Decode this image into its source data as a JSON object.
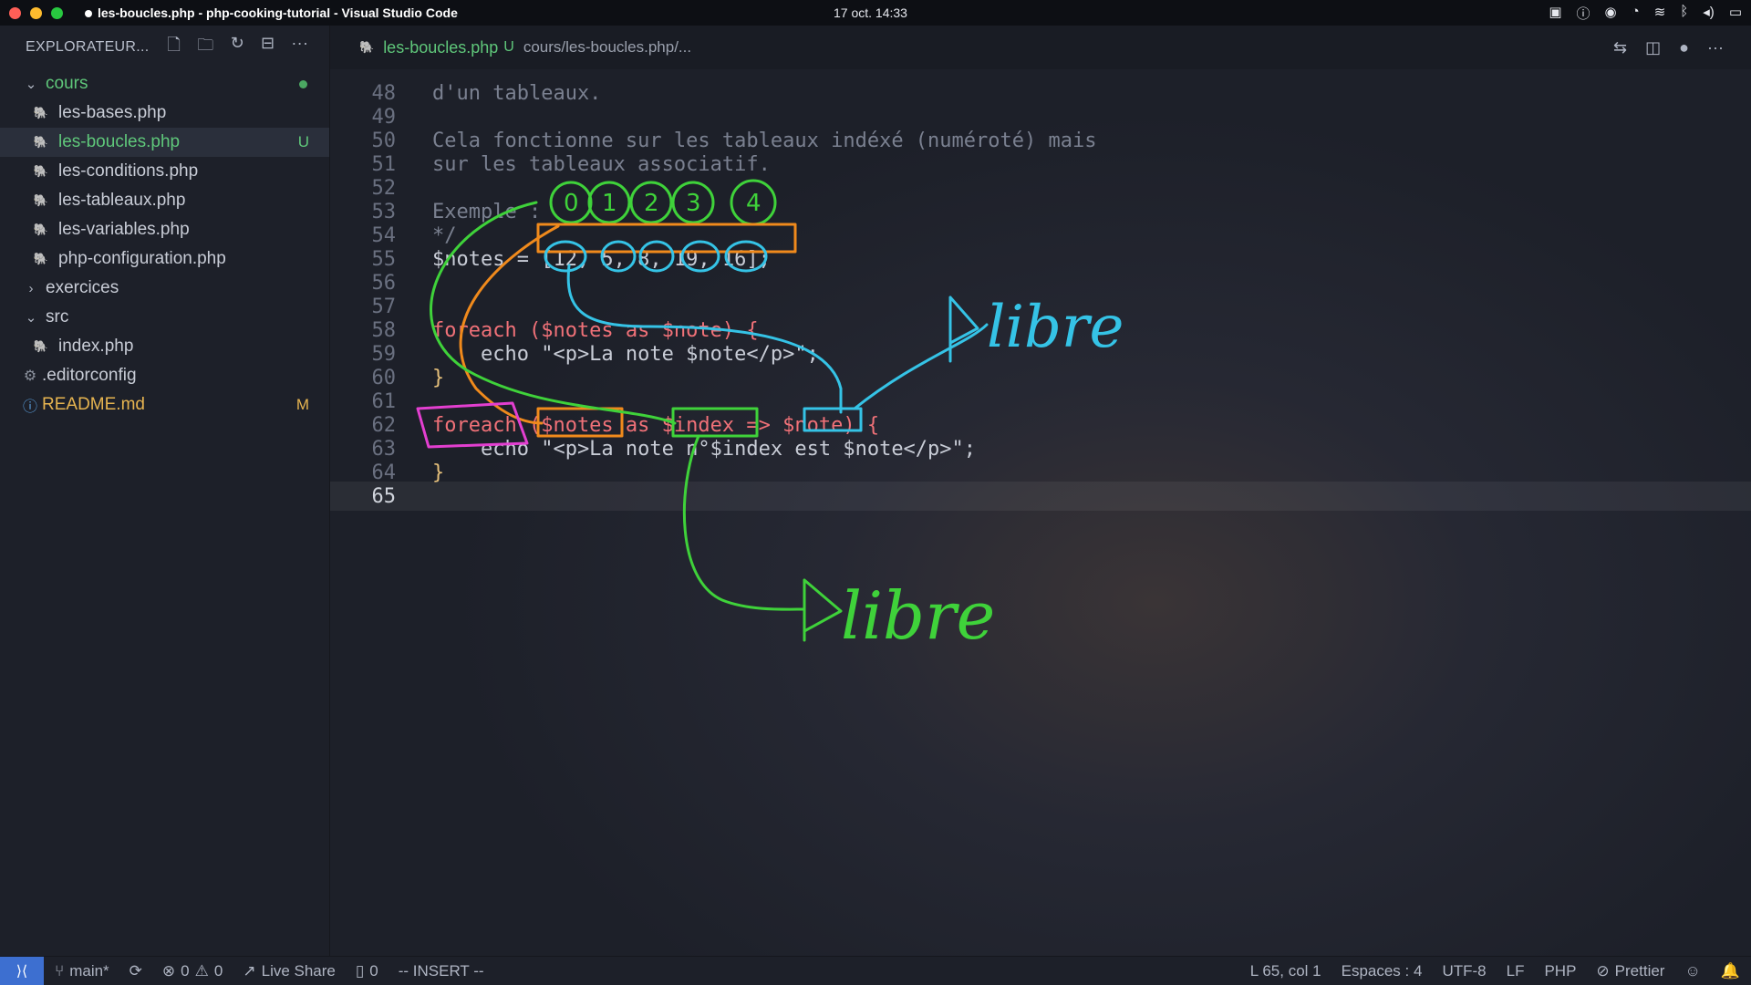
{
  "window": {
    "title": "les-boucles.php - php-cooking-tutorial - Visual Studio Code",
    "clock": "17 oct.  14:33"
  },
  "sidebar": {
    "title": "EXPLORATEUR...",
    "items": [
      {
        "label": "cours",
        "kind": "folder",
        "expanded": true,
        "status": ""
      },
      {
        "label": "les-bases.php",
        "kind": "php",
        "status": ""
      },
      {
        "label": "les-boucles.php",
        "kind": "php",
        "status": "U"
      },
      {
        "label": "les-conditions.php",
        "kind": "php",
        "status": ""
      },
      {
        "label": "les-tableaux.php",
        "kind": "php",
        "status": ""
      },
      {
        "label": "les-variables.php",
        "kind": "php",
        "status": ""
      },
      {
        "label": "php-configuration.php",
        "kind": "php",
        "status": ""
      },
      {
        "label": "exercices",
        "kind": "folder",
        "expanded": false,
        "status": ""
      },
      {
        "label": "src",
        "kind": "folder",
        "expanded": true,
        "status": ""
      },
      {
        "label": "index.php",
        "kind": "php",
        "status": ""
      },
      {
        "label": ".editorconfig",
        "kind": "config",
        "status": ""
      },
      {
        "label": "README.md",
        "kind": "info",
        "status": "M"
      }
    ]
  },
  "tab": {
    "name": "les-boucles.php",
    "status": "U",
    "breadcrumb": "cours/les-boucles.php/..."
  },
  "code": {
    "lines": [
      {
        "n": "48",
        "text": "d'un tableaux."
      },
      {
        "n": "49",
        "text": ""
      },
      {
        "n": "50",
        "text": "Cela fonctionne sur les tableaux indéxé (numéroté) mais"
      },
      {
        "n": "51",
        "text": "sur les tableaux associatif."
      },
      {
        "n": "52",
        "text": ""
      },
      {
        "n": "53",
        "text": "Exemple :"
      },
      {
        "n": "54",
        "text": "*/"
      },
      {
        "n": "55",
        "text": "$notes = [12, 5, 8, 19, 16];"
      },
      {
        "n": "56",
        "text": ""
      },
      {
        "n": "57",
        "text": ""
      },
      {
        "n": "58",
        "text": "foreach ($notes as $note) {"
      },
      {
        "n": "59",
        "text": "    echo \"<p>La note $note</p>\";"
      },
      {
        "n": "60",
        "text": "}"
      },
      {
        "n": "61",
        "text": ""
      },
      {
        "n": "62",
        "text": "foreach ($notes as $index => $note) {"
      },
      {
        "n": "63",
        "text": "    echo \"<p>La note n°$index est $note</p>\";"
      },
      {
        "n": "64",
        "text": "}"
      },
      {
        "n": "65",
        "text": ""
      }
    ]
  },
  "annotations": {
    "indices": [
      "0",
      "1",
      "2",
      "3",
      "4"
    ],
    "libre_top": "libre",
    "libre_bottom": "libre"
  },
  "statusbar": {
    "branch": "main*",
    "errors": "0",
    "warnings": "0",
    "liveshare": "Live Share",
    "ports": "0",
    "mode": "-- INSERT --",
    "position": "L 65, col 1",
    "spaces": "Espaces : 4",
    "encoding": "UTF-8",
    "eol": "LF",
    "language": "PHP",
    "formatter": "Prettier"
  },
  "colors": {
    "accent": "#3d6fd0",
    "green_marker": "#3fd23a",
    "orange_marker": "#f08a1c",
    "cyan_marker": "#35c3e6",
    "magenta_marker": "#e33fd0"
  }
}
